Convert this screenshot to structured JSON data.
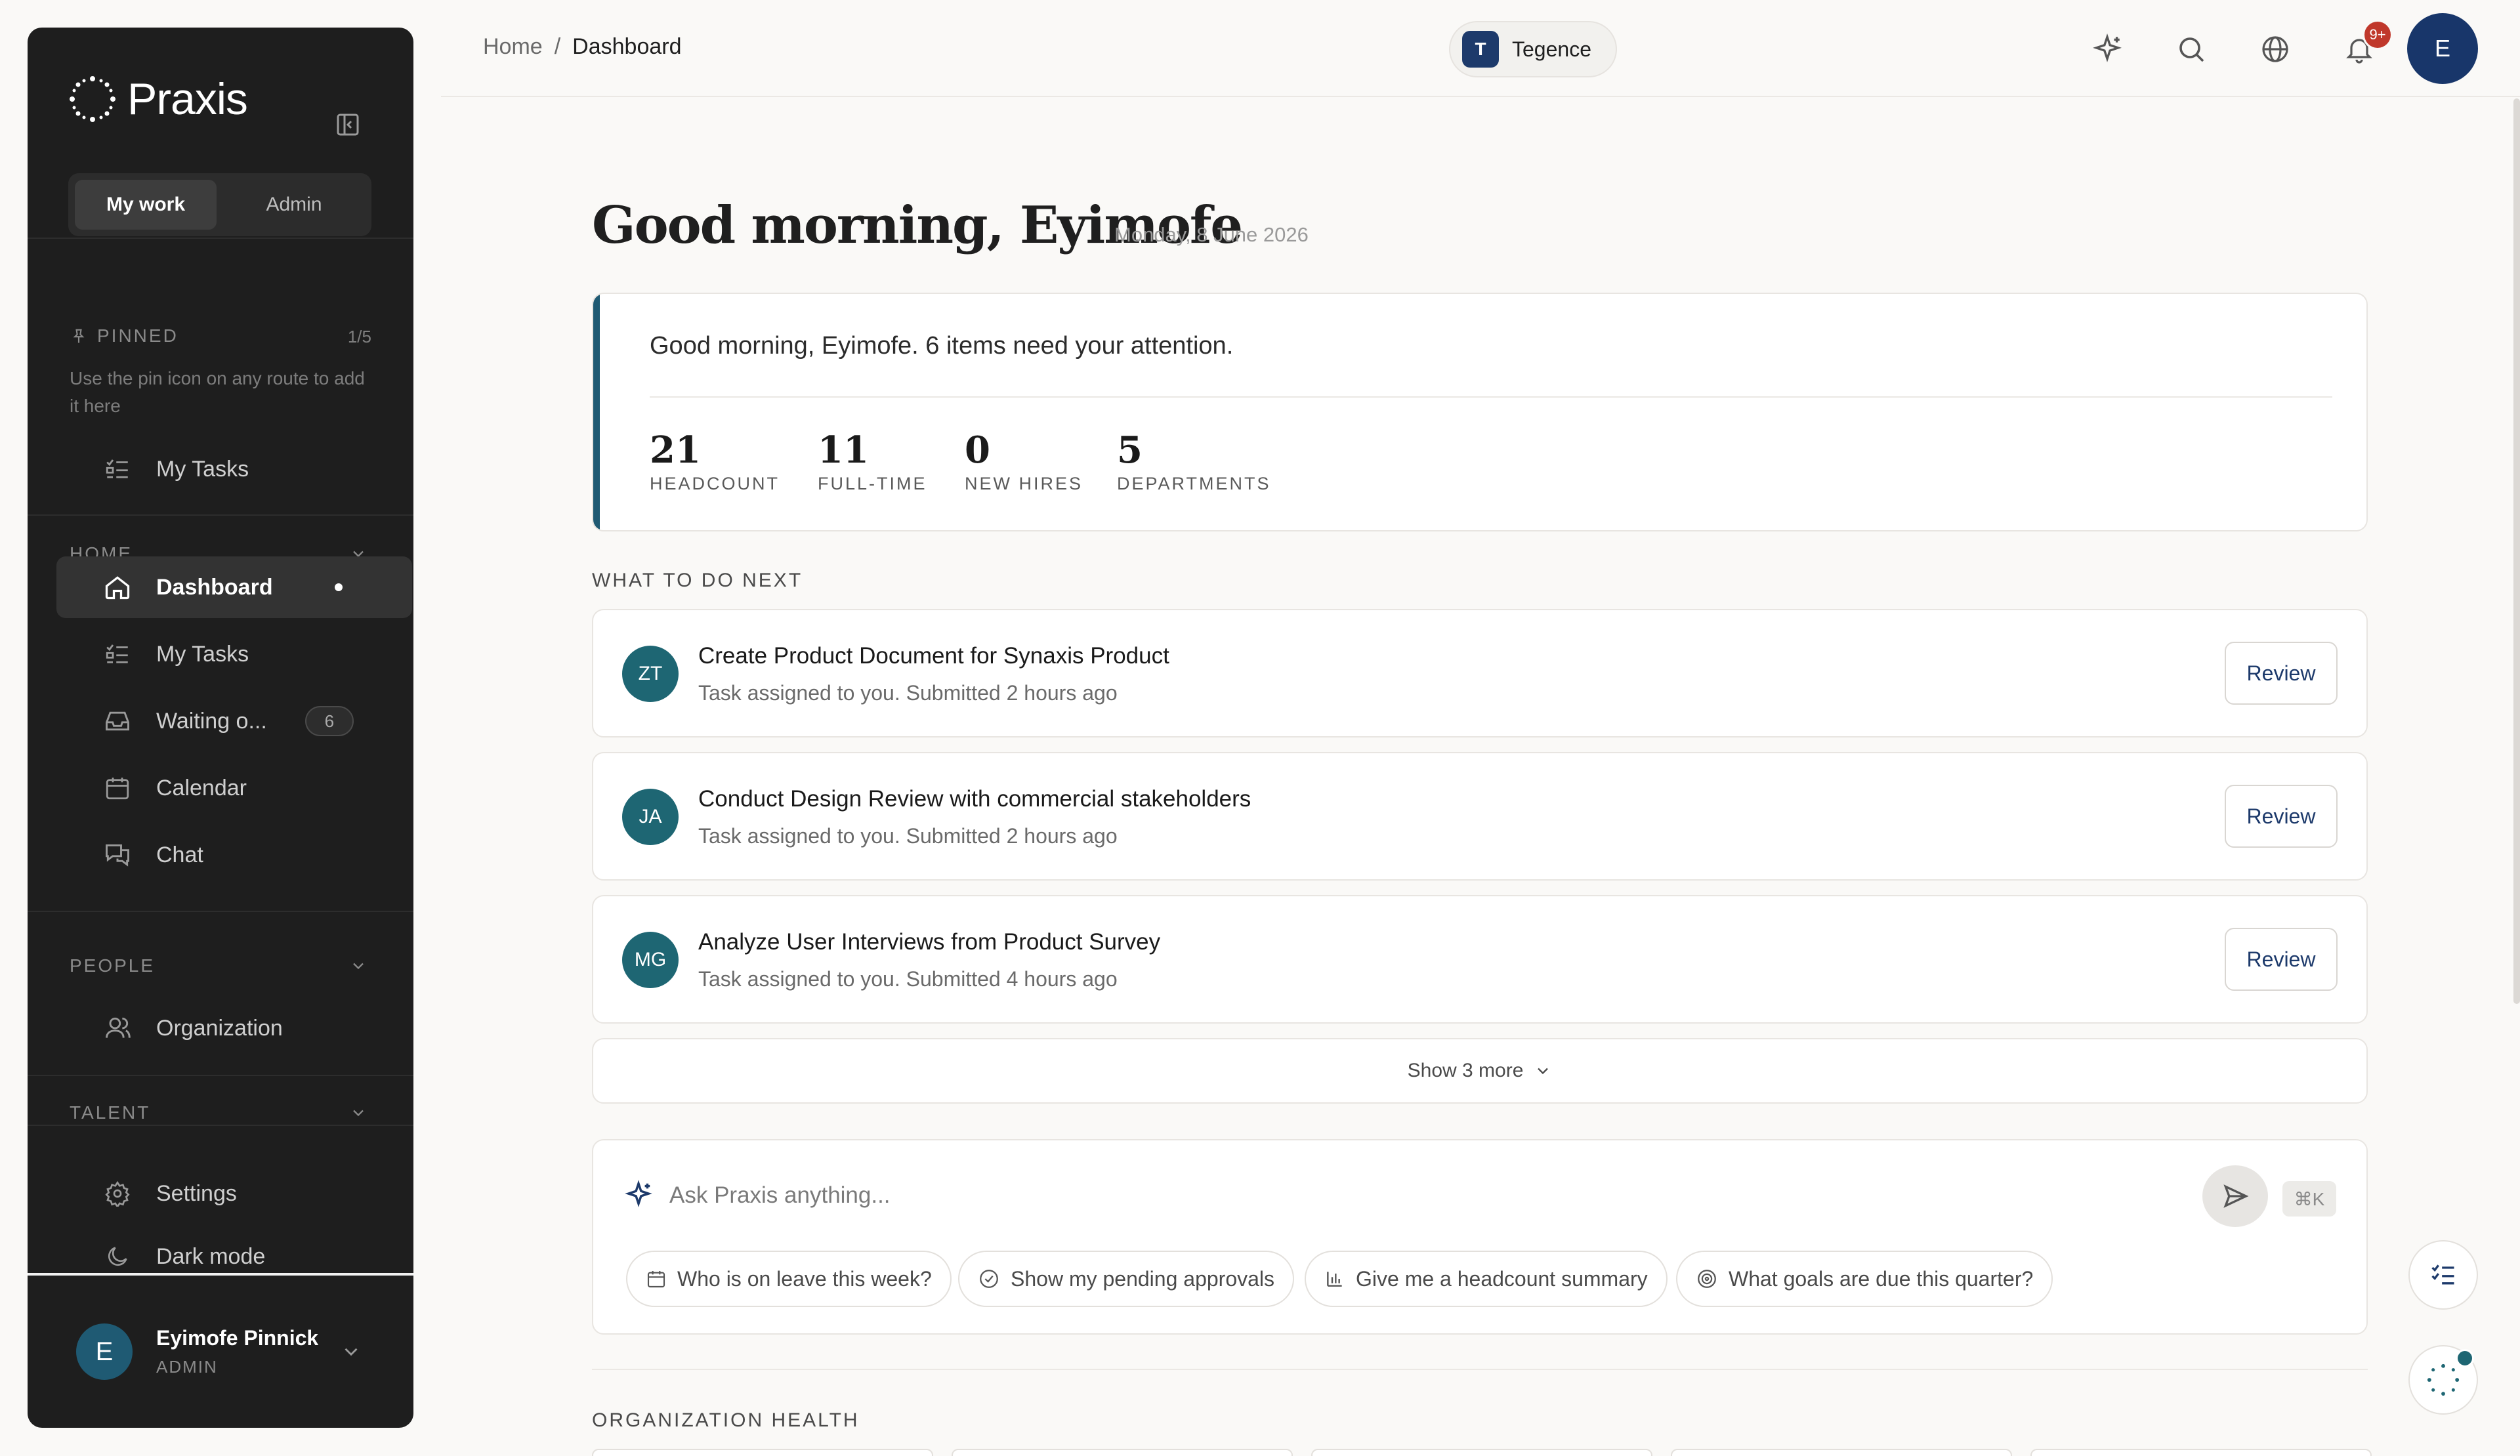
{
  "sidebar": {
    "brand": "Praxis",
    "segments": [
      "My work",
      "Admin"
    ],
    "pinned": {
      "label": "PINNED",
      "count": "1/5",
      "hint": "Use the pin icon on any route to add it here",
      "items": [
        {
          "label": "My Tasks",
          "icon": "list-check-icon"
        }
      ]
    },
    "home": {
      "label": "HOME",
      "items": [
        {
          "label": "Dashboard",
          "icon": "home-icon"
        },
        {
          "label": "My Tasks",
          "icon": "list-check-icon"
        },
        {
          "label": "Waiting o...",
          "icon": "inbox-icon",
          "badge": "6"
        },
        {
          "label": "Calendar",
          "icon": "calendar-icon"
        },
        {
          "label": "Chat",
          "icon": "chat-icon"
        }
      ]
    },
    "people": {
      "label": "PEOPLE",
      "items": [
        {
          "label": "Organization",
          "icon": "users-icon"
        }
      ]
    },
    "talent": {
      "label": "TALENT"
    },
    "bottom": [
      {
        "label": "Settings",
        "icon": "gear-icon"
      },
      {
        "label": "Dark mode",
        "icon": "moon-icon"
      }
    ],
    "profile": {
      "initial": "E",
      "name": "Eyimofe Pinnick",
      "role": "ADMIN"
    }
  },
  "topbar": {
    "breadcrumb": [
      "Home",
      "/",
      "Dashboard"
    ],
    "org": {
      "initial": "T",
      "name": "Tegence"
    },
    "notifications": "9+",
    "avatar": "E"
  },
  "main": {
    "greeting": "Good morning, Eyimofe",
    "date": "Monday, 8 June 2026",
    "summary": {
      "message": "Good morning, Eyimofe. 6 items need your attention.",
      "stats": [
        {
          "value": "21",
          "label": "HEADCOUNT"
        },
        {
          "value": "11",
          "label": "FULL-TIME"
        },
        {
          "value": "0",
          "label": "NEW HIRES"
        },
        {
          "value": "5",
          "label": "DEPARTMENTS"
        }
      ]
    },
    "next_title": "WHAT TO DO NEXT",
    "tasks": [
      {
        "initials": "ZT",
        "title": "Create Product Document for Synaxis Product",
        "sub": "Task assigned to you. Submitted 2 hours ago",
        "action": "Review"
      },
      {
        "initials": "JA",
        "title": "Conduct Design Review with commercial stakeholders",
        "sub": "Task assigned to you. Submitted 2 hours ago",
        "action": "Review"
      },
      {
        "initials": "MG",
        "title": "Analyze User Interviews from Product Survey",
        "sub": "Task assigned to you. Submitted 4 hours ago",
        "action": "Review"
      }
    ],
    "show_more": "Show 3 more",
    "ask": {
      "placeholder": "Ask Praxis anything...",
      "shortcut": "⌘K",
      "chips": [
        {
          "label": "Who is on leave this week?",
          "icon": "calendar-icon"
        },
        {
          "label": "Show my pending approvals",
          "icon": "check-circle-icon"
        },
        {
          "label": "Give me a headcount summary",
          "icon": "bar-chart-icon"
        },
        {
          "label": "What goals are due this quarter?",
          "icon": "target-icon"
        }
      ]
    },
    "health_title": "ORGANIZATION HEALTH"
  },
  "colors": {
    "sidebar": "#1e1e1e",
    "accent": "#1f5a73",
    "brand_blue": "#18366a",
    "notif": "#c0382b"
  }
}
